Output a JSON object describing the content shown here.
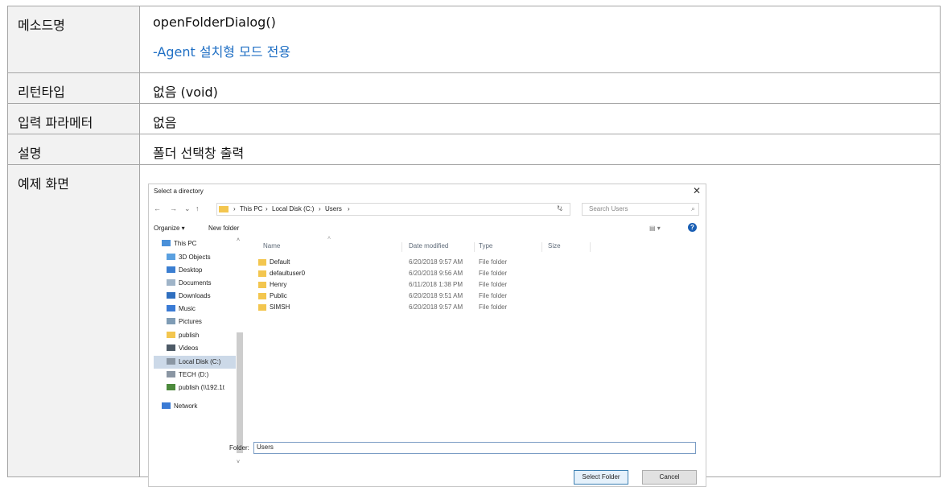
{
  "table": {
    "rows": [
      {
        "label": "메소드명",
        "value": "openFolderDialog()",
        "note": "-Agent 설치형 모드 전용"
      },
      {
        "label": "리턴타입",
        "value": "없음 (void)"
      },
      {
        "label": "입력 파라메터",
        "value": "없음"
      },
      {
        "label": "설명",
        "value": "폴더 선택창 출력"
      },
      {
        "label": "예제 화면"
      }
    ]
  },
  "dialog": {
    "title": "Select a directory",
    "close_glyph": "✕",
    "nav": {
      "back": "←",
      "forward": "→",
      "recent": "⌄",
      "up": "↑"
    },
    "breadcrumb": [
      "This PC",
      "Local Disk (C:)",
      "Users"
    ],
    "breadcrumb_sep": "›",
    "address_dropdown": "⌄",
    "refresh_glyph": "↻",
    "search_placeholder": "Search Users",
    "search_glyph": "⌕",
    "toolbar": {
      "organize": "Organize ▾",
      "new_folder": "New folder",
      "view": "▤ ▾",
      "help": "?"
    },
    "tree": [
      {
        "label": "This PC",
        "icon": "pc-icon",
        "color": "#4a90d9"
      },
      {
        "label": "3D Objects",
        "icon": "cube-icon",
        "color": "#5aa0e0"
      },
      {
        "label": "Desktop",
        "icon": "desktop-icon",
        "color": "#3b7ed1"
      },
      {
        "label": "Documents",
        "icon": "document-icon",
        "color": "#9fb4c8"
      },
      {
        "label": "Downloads",
        "icon": "download-icon",
        "color": "#2f6fbf"
      },
      {
        "label": "Music",
        "icon": "music-icon",
        "color": "#3a7bd5"
      },
      {
        "label": "Pictures",
        "icon": "pictures-icon",
        "color": "#7f9cb5"
      },
      {
        "label": "publish",
        "icon": "folder-icon",
        "color": "#f3c64f"
      },
      {
        "label": "Videos",
        "icon": "videos-icon",
        "color": "#4d5a66"
      },
      {
        "label": "Local Disk (C:)",
        "icon": "drive-icon",
        "color": "#8a96a3",
        "selected": true
      },
      {
        "label": "TECH (D:)",
        "icon": "drive-icon",
        "color": "#8a96a3"
      },
      {
        "label": "publish (\\\\192.1t",
        "icon": "network-drive-icon",
        "color": "#4c8a3c"
      },
      {
        "label": "Network",
        "icon": "network-icon",
        "color": "#3a7bd5"
      }
    ],
    "scroll": {
      "up": "˄",
      "down": "˅"
    },
    "columns": {
      "name": "Name",
      "date": "Date modified",
      "type": "Type",
      "size": "Size",
      "sort": "˄"
    },
    "files": [
      {
        "name": "Default",
        "date": "6/20/2018 9:57 AM",
        "type": "File folder"
      },
      {
        "name": "defaultuser0",
        "date": "6/20/2018 9:56 AM",
        "type": "File folder"
      },
      {
        "name": "Henry",
        "date": "6/11/2018 1:38 PM",
        "type": "File folder"
      },
      {
        "name": "Public",
        "date": "6/20/2018 9:51 AM",
        "type": "File folder"
      },
      {
        "name": "SIMSH",
        "date": "6/20/2018 9:57 AM",
        "type": "File folder"
      }
    ],
    "folder_label": "Folder:",
    "folder_value": "Users",
    "select_button": "Select Folder",
    "cancel_button": "Cancel"
  }
}
